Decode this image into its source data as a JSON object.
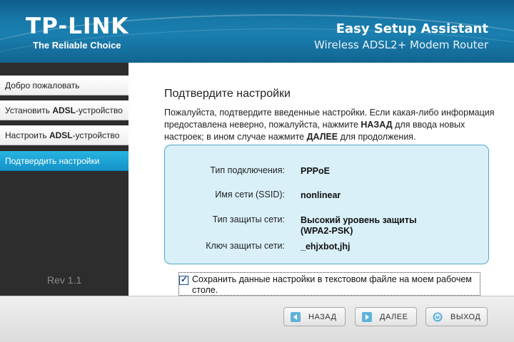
{
  "header": {
    "logo": "TP-LINK",
    "tagline": "The Reliable Choice",
    "title": "Easy Setup Assistant",
    "subtitle": "Wireless ADSL2+ Modem Router"
  },
  "sidebar": {
    "items": [
      {
        "prefix": "Добро пожаловать",
        "bold": "",
        "suffix": "",
        "active": false
      },
      {
        "prefix": "Установить ",
        "bold": "ADSL",
        "suffix": "-устройство",
        "active": false
      },
      {
        "prefix": "Настроить ",
        "bold": "ADSL",
        "suffix": "-устройство",
        "active": false
      },
      {
        "prefix": "Подтвердить настройки",
        "bold": "",
        "suffix": "",
        "active": true
      }
    ],
    "revision": "Rev 1.1"
  },
  "main": {
    "title": "Подтвердите настройки",
    "intro_part1": "Пожалуйста, подтвердите введенные настройки. Если какая-либо информация предоставлена неверно, пожалуйста, нажмите ",
    "intro_back": "НАЗАД",
    "intro_part2": " для ввода новых настроек; в ином случае нажмите ",
    "intro_next": "ДАЛЕЕ",
    "intro_part3": " для продолжения.",
    "summary": {
      "connection_type_label": "Тип подключения:",
      "connection_type_value": "PPPoE",
      "ssid_label": "Имя сети (SSID):",
      "ssid_value": "nonlinear",
      "security_label": "Тип защиты сети:",
      "security_value_line1": "Высокий уровень защиты",
      "security_value_line2": "(WPA2-PSK)",
      "key_label": "Ключ защиты сети:",
      "key_value": "_ehjxbot,jhj"
    },
    "save_checkbox": {
      "checked": true,
      "label": "Сохранить данные настройки в текстовом файле на моем рабочем столе."
    }
  },
  "footer": {
    "back_label": "НАЗАД",
    "next_label": "ДАЛЕЕ",
    "exit_label": "ВЫХОД"
  },
  "colors": {
    "header_blue": "#1778a8",
    "active_item": "#1a9fd4",
    "summary_bg": "#d9f0f9"
  }
}
